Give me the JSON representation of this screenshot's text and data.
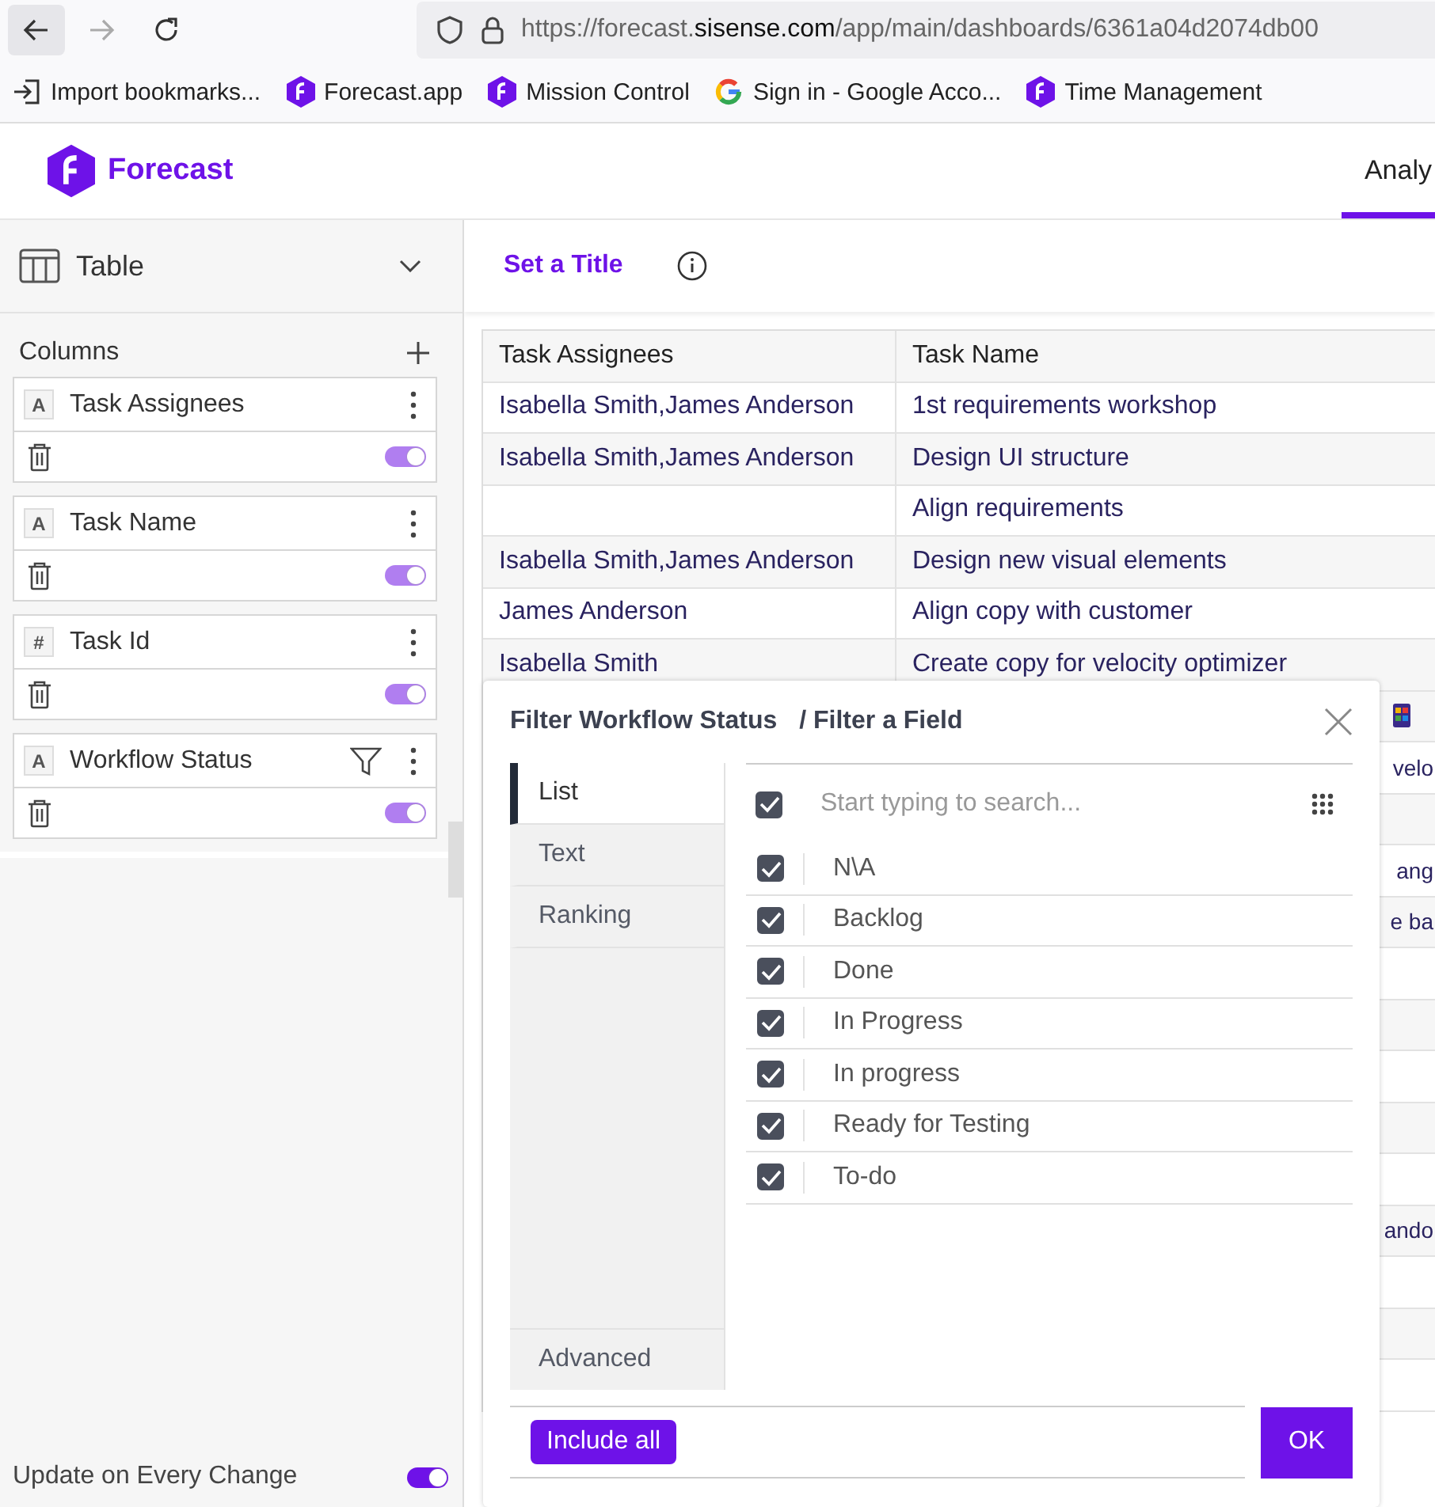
{
  "browser": {
    "url": {
      "scheme": "https://forecast.",
      "host": "sisense.com",
      "path": "/app/main/dashboards/6361a04d2074db00"
    },
    "bookmarks": [
      {
        "label": "Import bookmarks...",
        "kind": "import"
      },
      {
        "label": "Forecast.app",
        "kind": "forecast"
      },
      {
        "label": "Mission Control",
        "kind": "forecast"
      },
      {
        "label": "Sign in - Google Acco...",
        "kind": "google"
      },
      {
        "label": "Time Management",
        "kind": "forecast"
      }
    ]
  },
  "app": {
    "logo": "Forecast",
    "tabs": [
      {
        "label": "Analy",
        "selected": true
      }
    ]
  },
  "sidebar": {
    "widget_type": "Table",
    "columns_label": "Columns",
    "columns": [
      {
        "name": "Task Assignees",
        "type_mark": "A",
        "filter": false,
        "on": true
      },
      {
        "name": "Task Name",
        "type_mark": "A",
        "filter": false,
        "on": true
      },
      {
        "name": "Task Id",
        "type_mark": "#",
        "filter": false,
        "on": true
      },
      {
        "name": "Workflow Status",
        "type_mark": "A",
        "filter": true,
        "on": true
      }
    ],
    "update": {
      "label": "Update on Every Change",
      "on": true
    }
  },
  "title": "Set a Title",
  "table": {
    "columns": [
      "Task Assignees",
      "Task Name"
    ],
    "rows": [
      {
        "assignees": "Isabella Smith,James Anderson",
        "task_name": "1st requirements workshop"
      },
      {
        "assignees": "Isabella Smith,James Anderson",
        "task_name": "Design UI structure"
      },
      {
        "assignees": "",
        "task_name": "Align requirements"
      },
      {
        "assignees": "Isabella Smith,James Anderson",
        "task_name": "Design new visual elements"
      },
      {
        "assignees": "James Anderson",
        "task_name": "Align copy with customer"
      },
      {
        "assignees": "Isabella Smith",
        "task_name": "Create copy for velocity optimizer"
      }
    ],
    "hidden_rows": [
      {
        "kind": "icon"
      },
      {
        "kind": "text",
        "fragment": "velo"
      },
      {
        "kind": "empty"
      },
      {
        "kind": "text",
        "fragment": "ang"
      },
      {
        "kind": "text",
        "fragment": "e ba"
      },
      {
        "kind": "empty"
      },
      {
        "kind": "empty"
      },
      {
        "kind": "empty"
      },
      {
        "kind": "empty"
      },
      {
        "kind": "empty"
      },
      {
        "kind": "text",
        "fragment": "ando"
      },
      {
        "kind": "empty"
      },
      {
        "kind": "empty"
      },
      {
        "kind": "empty"
      }
    ]
  },
  "filter": {
    "title": "Filter Workflow Status",
    "subtitle": "/ Filter a Field",
    "tabs": [
      {
        "label": "List",
        "selected": true
      },
      {
        "label": "Text",
        "selected": false
      },
      {
        "label": "Ranking",
        "selected": false
      }
    ],
    "advanced": "Advanced",
    "select_all": true,
    "search_placeholder": "Start typing to search...",
    "items": [
      {
        "label": "N\\A",
        "checked": true
      },
      {
        "label": "Backlog",
        "checked": true
      },
      {
        "label": "Done",
        "checked": true
      },
      {
        "label": "In Progress",
        "checked": true
      },
      {
        "label": "In progress",
        "checked": true
      },
      {
        "label": "Ready for Testing",
        "checked": true
      },
      {
        "label": "To-do",
        "checked": true
      }
    ],
    "include_all": "Include all",
    "ok": "OK"
  }
}
